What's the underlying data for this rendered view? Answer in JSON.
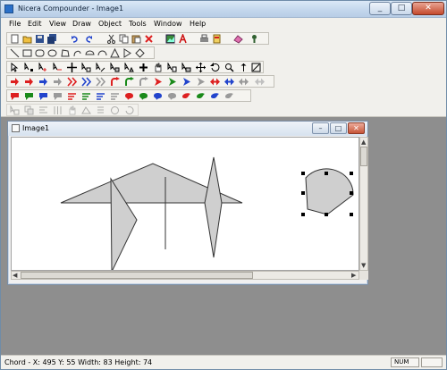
{
  "app": {
    "title": "Nicera Compounder - Image1",
    "window_controls": [
      "_",
      "□",
      "✕"
    ]
  },
  "menus": [
    "File",
    "Edit",
    "View",
    "Draw",
    "Object",
    "Tools",
    "Window",
    "Help"
  ],
  "toolbars": {
    "standard": [
      "new",
      "open",
      "save",
      "save-all",
      "undo",
      "redo",
      "cut",
      "copy",
      "paste",
      "delete",
      "picture",
      "text",
      "print",
      "print-preview",
      "help"
    ],
    "shapes": [
      "line",
      "rectangle",
      "rounded-rect",
      "ellipse",
      "polygon",
      "freeform",
      "chord",
      "arc",
      "triangle",
      "arrow",
      "diamond"
    ],
    "tools": [
      "select",
      "move-point",
      "add-point",
      "delete-point",
      "crosshair",
      "edit-1",
      "edit-2",
      "edit-3",
      "edit-4",
      "plus",
      "tool-a",
      "tool-b",
      "tool-c",
      "move",
      "rotate",
      "zoom",
      "flip-v",
      "flip-h"
    ],
    "arrows_1": [
      "arrow-right-red",
      "arrow-right-red-2",
      "arrow-right-red-3",
      "arrow-right-gray",
      "arrow-dbl-red",
      "arrow-dbl-blue",
      "arrow-dbl-gray",
      "arrow-curve-red",
      "arrow-curve-blue",
      "arrow-curve-gray",
      "arrow-play-red",
      "arrow-play-green",
      "arrow-play-blue",
      "arrow-play-gray",
      "arrow-both-red",
      "arrow-both-blue",
      "arrow-both-gray"
    ],
    "arrows_2": [
      "callout-red",
      "callout-green",
      "callout-blue",
      "callout-gray",
      "lines-red",
      "lines-green",
      "lines-blue",
      "lines-gray",
      "blob-red",
      "blob-green",
      "blob-blue",
      "blob-gray",
      "drop-red",
      "drop-green",
      "drop-blue",
      "drop-gray"
    ],
    "disabled": [
      "d1",
      "d2",
      "d3",
      "d4",
      "d5",
      "d6",
      "d7",
      "d8",
      "d9"
    ]
  },
  "document": {
    "title": "Image1",
    "controls": [
      "–",
      "□",
      "✕"
    ]
  },
  "statusbar": {
    "text": "Chord - X: 495  Y: 55  Width: 83  Height: 74",
    "num": "NUM"
  },
  "colors": {
    "shape_fill": "#cfcfcf",
    "shape_stroke": "#333333",
    "red": "#dd2020",
    "blue": "#2244cc",
    "green": "#1a8a1a"
  }
}
